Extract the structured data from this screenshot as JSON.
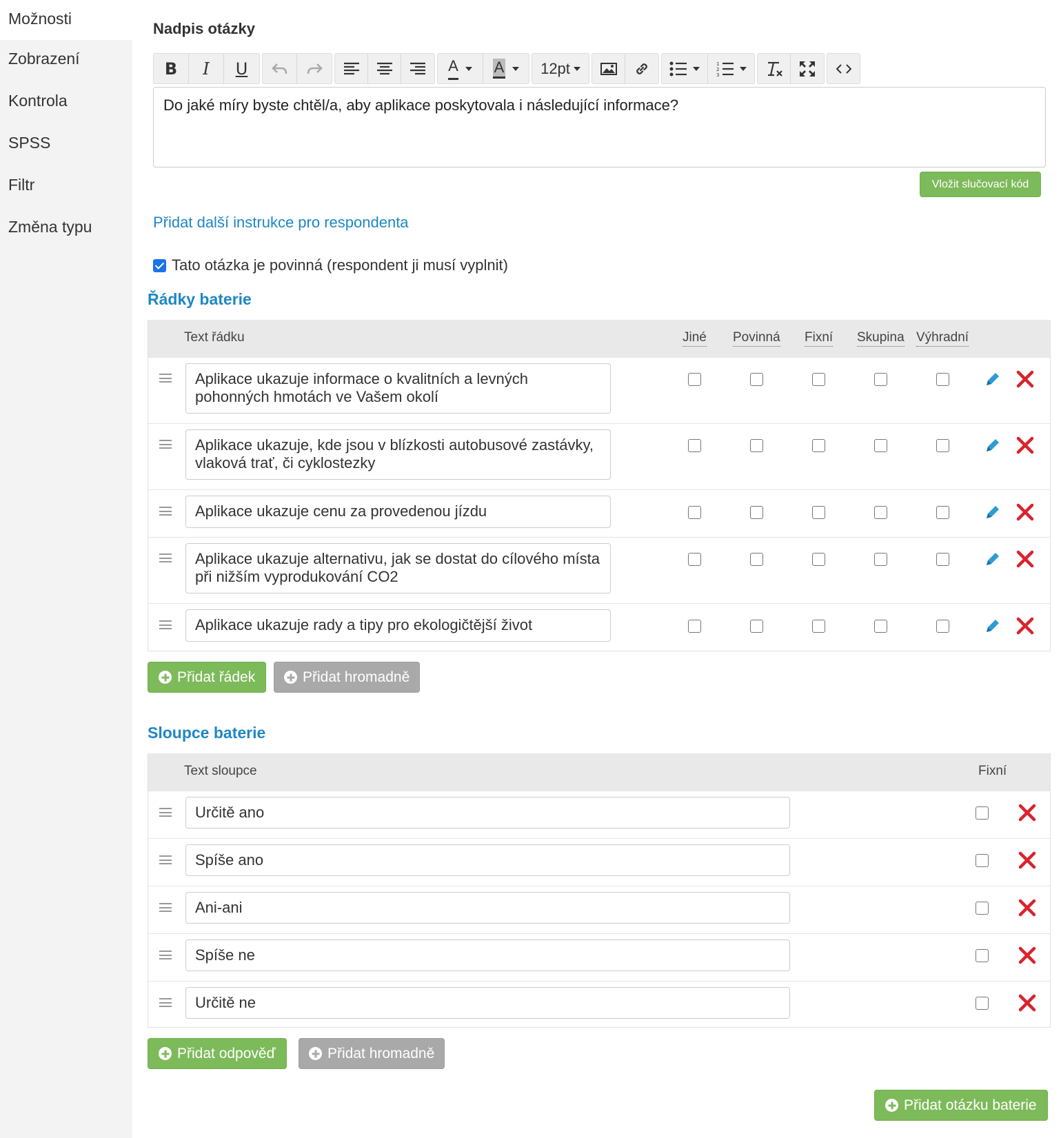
{
  "sidebar": {
    "items": [
      {
        "label": "Možnosti",
        "active": true
      },
      {
        "label": "Zobrazení",
        "active": false
      },
      {
        "label": "Kontrola",
        "active": false
      },
      {
        "label": "SPSS",
        "active": false
      },
      {
        "label": "Filtr",
        "active": false
      },
      {
        "label": "Změna typu",
        "active": false
      }
    ]
  },
  "question": {
    "label": "Nadpis otázky",
    "toolbar": {
      "bold": "B",
      "italic": "I",
      "underline": "U",
      "font_color": "A",
      "bg_color": "A",
      "font_size": "12pt",
      "icons": [
        "undo-icon",
        "redo-icon",
        "align-left-icon",
        "align-center-icon",
        "align-right-icon",
        "image-icon",
        "link-icon",
        "bullet-list-icon",
        "numbered-list-icon",
        "clear-format-icon",
        "fullscreen-icon",
        "source-code-icon"
      ]
    },
    "text": "Do jaké míry byste chtěl/a, aby aplikace poskytovala i následující informace?",
    "merge_button": "Vložit slučovací kód",
    "instructions_link": "Přidat další instrukce pro respondenta",
    "required_label": "Tato otázka je povinná (respondent ji musí vyplnit)",
    "required_checked": true
  },
  "rows_section": {
    "title": "Řádky baterie",
    "headers": {
      "text": "Text řádku",
      "other": "Jiné",
      "required": "Povinná",
      "fixed": "Fixní",
      "group": "Skupina",
      "exclusive": "Výhradní"
    },
    "rows": [
      {
        "text": "Aplikace ukazuje informace o kvalitních a levných pohonných hmotách ve Vašem okolí"
      },
      {
        "text": "Aplikace ukazuje, kde jsou v blízkosti autobusové zastávky, vlaková trať, či cyklostezky"
      },
      {
        "text": "Aplikace ukazuje cenu za provedenou jízdu"
      },
      {
        "text": "Aplikace ukazuje alternativu, jak se dostat do cílového místa při nižším vyprodukování CO2"
      },
      {
        "text": "Aplikace ukazuje rady a tipy pro ekologičtější život"
      }
    ],
    "add_button": "Přidat řádek",
    "bulk_button": "Přidat hromadně"
  },
  "columns_section": {
    "title": "Sloupce baterie",
    "headers": {
      "text": "Text sloupce",
      "fixed": "Fixní"
    },
    "columns": [
      {
        "text": "Určitě ano"
      },
      {
        "text": "Spíše ano"
      },
      {
        "text": "Ani-ani"
      },
      {
        "text": "Spíše ne"
      },
      {
        "text": "Určitě ne"
      }
    ],
    "add_button": "Přidat odpověď",
    "bulk_button": "Přidat hromadně"
  },
  "add_battery_button": "Přidat otázku baterie",
  "colors": {
    "accent_blue": "#1e87c5",
    "green_button": "#7dba5a",
    "grey_button": "#a9a9a9",
    "delete_red": "#d9232d",
    "checkbox_blue": "#1a73e8"
  }
}
